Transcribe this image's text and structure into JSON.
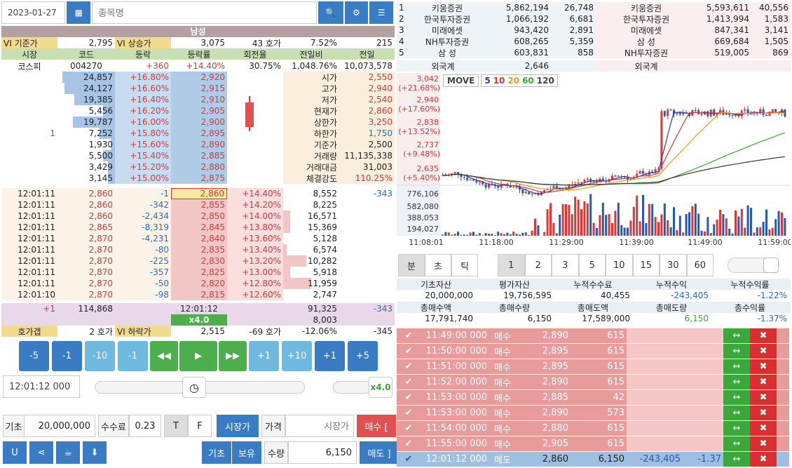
{
  "top": {
    "date": "2023-01-27",
    "stock_placeholder": "종목명"
  },
  "title": "남성",
  "vi": {
    "base_label": "VI 기준가",
    "base": "2,795",
    "up_label": "VI 상승가",
    "up": "3,075",
    "ticks": "43 호가",
    "pct": "7.52%",
    "val": "215"
  },
  "hdr": [
    "시장",
    "코드",
    "등락",
    "등락률",
    "회전율",
    "전일비",
    "전일"
  ],
  "info": [
    "코스피",
    "004270",
    "+360",
    "+14.40%",
    "30.75%",
    "1,048.76%",
    "10,073,578"
  ],
  "asks": [
    {
      "cnt": "",
      "qty": "24,857",
      "pct": "+16.80%",
      "price": "2,920",
      "w": 75
    },
    {
      "cnt": "",
      "qty": "24,127",
      "pct": "+16.60%",
      "price": "2,915",
      "w": 72
    },
    {
      "cnt": "",
      "qty": "19,385",
      "pct": "+16.40%",
      "price": "2,910",
      "w": 58
    },
    {
      "cnt": "",
      "qty": "5,456",
      "pct": "+16.20%",
      "price": "2,905",
      "w": 17
    },
    {
      "cnt": "",
      "qty": "19,787",
      "pct": "+16.00%",
      "price": "2,900",
      "w": 60
    },
    {
      "cnt": "1",
      "qty": "7,252",
      "pct": "+15.80%",
      "price": "2,895",
      "w": 22
    },
    {
      "cnt": "",
      "qty": "1,930",
      "pct": "+15.60%",
      "price": "2,890",
      "w": 6
    },
    {
      "cnt": "",
      "qty": "5,500",
      "pct": "+15.40%",
      "price": "2,885",
      "w": 17
    },
    {
      "cnt": "",
      "qty": "3,429",
      "pct": "+15.20%",
      "price": "2,880",
      "w": 10
    },
    {
      "cnt": "",
      "qty": "3,145",
      "pct": "+15.00%",
      "price": "2,875",
      "w": 10
    }
  ],
  "stats": [
    {
      "k": "시가",
      "v": "2,550",
      "c": "red"
    },
    {
      "k": "고가",
      "v": "2,940",
      "c": "red"
    },
    {
      "k": "저가",
      "v": "2,540",
      "c": "red"
    },
    {
      "k": "현재가",
      "v": "2,860",
      "c": "red"
    },
    {
      "k": "상한가",
      "v": "3,250",
      "c": "red"
    },
    {
      "k": "하한가",
      "v": "1,750",
      "c": "blue"
    },
    {
      "k": "기준가",
      "v": "2,500",
      "c": ""
    },
    {
      "k": "거래량",
      "v": "11,135,338",
      "c": ""
    },
    {
      "k": "거래대금",
      "v": "31,003",
      "c": ""
    },
    {
      "k": "체결강도",
      "v": "110.25%",
      "c": "red"
    }
  ],
  "ticks": [
    {
      "t": "12:01:11",
      "p": "2,860",
      "d": "-1",
      "bp": "2,860",
      "pct": "+14.40%",
      "q": "8,552",
      "x": "-343",
      "w": 0
    },
    {
      "t": "12:01:11",
      "p": "2,860",
      "d": "-342",
      "bp": "2,855",
      "pct": "+14.20%",
      "q": "8,225",
      "x": "",
      "w": 0
    },
    {
      "t": "12:01:11",
      "p": "2,860",
      "d": "-2,434",
      "bp": "2,850",
      "pct": "+14.00%",
      "q": "16,571",
      "x": "",
      "w": 10
    },
    {
      "t": "12:01:11",
      "p": "2,865",
      "d": "-8,319",
      "bp": "2,845",
      "pct": "+13.80%",
      "q": "15,369",
      "x": "",
      "w": 10
    },
    {
      "t": "12:01:11",
      "p": "2,870",
      "d": "-4,231",
      "bp": "2,840",
      "pct": "+13.60%",
      "q": "5,128",
      "x": "",
      "w": 0
    },
    {
      "t": "12:01:11",
      "p": "2,870",
      "d": "-80",
      "bp": "2,835",
      "pct": "+13.40%",
      "q": "6,574",
      "x": "",
      "w": 5
    },
    {
      "t": "12:01:11",
      "p": "2,870",
      "d": "-225",
      "bp": "2,830",
      "pct": "+13.20%",
      "q": "10,282",
      "x": "",
      "w": 33
    },
    {
      "t": "12:01:11",
      "p": "2,870",
      "d": "-357",
      "bp": "2,825",
      "pct": "+13.00%",
      "q": "5,918",
      "x": "",
      "w": 10
    },
    {
      "t": "12:01:11",
      "p": "2,870",
      "d": "-50",
      "bp": "2,820",
      "pct": "+12.80%",
      "q": "11,959",
      "x": "",
      "w": 40
    },
    {
      "t": "12:01:10",
      "p": "2,870",
      "d": "-98",
      "bp": "2,815",
      "pct": "+12.60%",
      "q": "2,747",
      "x": "",
      "w": 0
    }
  ],
  "sum": {
    "cnt": "+1",
    "qty": "114,868",
    "time": "12:01:12",
    "bq": "91,325",
    "x": "-343",
    "speed": "x4.0",
    "q2": "8,003"
  },
  "gap": {
    "label": "호가갭",
    "ticks": "2 호가",
    "down_label": "VI 하락가",
    "down": "2,515",
    "dt": "-69 호가",
    "dp": "-12.06%",
    "dv": "-345"
  },
  "ctrl": [
    "-5",
    "-1",
    "-10",
    "-1",
    "◀◀",
    "▶",
    "▶▶",
    "+1",
    "+10",
    "+1",
    "+5"
  ],
  "time_field": "12:01:12 000",
  "speed_label": "x4.0",
  "trade": {
    "base_label": "기초",
    "base": "20,000,000",
    "fee_label": "수수료",
    "fee": "0.23",
    "t": "T",
    "f": "F",
    "market": "시장가",
    "price_label": "가격",
    "price_ph": "시장가",
    "buy": "매수 [",
    "qty_label": "수량",
    "qty": "6,150",
    "sell": "매도 ]",
    "b1": "기초",
    "b2": "보유"
  },
  "brokers": [
    {
      "n": "1",
      "s": "키움증권",
      "q": "5,862,194",
      "v": "26,748",
      "b": "키움증권",
      "bq": "5,593,611",
      "bv": "40,556"
    },
    {
      "n": "2",
      "s": "한국투자증권",
      "q": "1,066,192",
      "v": "6,681",
      "b": "한국투자증권",
      "bq": "1,413,994",
      "bv": "1,583"
    },
    {
      "n": "3",
      "s": "미래에셋",
      "q": "943,420",
      "v": "2,891",
      "b": "미래에셋",
      "bq": "847,341",
      "bv": "3,141"
    },
    {
      "n": "4",
      "s": "NH투자증권",
      "q": "608,265",
      "v": "5,359",
      "b": "삼 성",
      "bq": "669,684",
      "bv": "1,505"
    },
    {
      "n": "5",
      "s": "삼 성",
      "q": "603,831",
      "v": "858",
      "b": "NH투자증권",
      "bq": "519,005",
      "bv": "869"
    }
  ],
  "foreign": {
    "label": "외국계",
    "q": "2,646",
    "label2": "외국계"
  },
  "chart": {
    "move": "MOVE",
    "ma": [
      "5",
      "10",
      "20",
      "60",
      "120"
    ],
    "prices": [
      {
        "p": "3,042",
        "r": "(+21.68%)"
      },
      {
        "p": "2,940",
        "r": "(+17.60%)"
      },
      {
        "p": "2,838",
        "r": "(+13.52%)"
      },
      {
        "p": "2,737",
        "r": "(+9.48%)"
      },
      {
        "p": "2,635",
        "r": "(+5.40%)"
      }
    ],
    "vols": [
      "776,106",
      "582,080",
      "388,053",
      "194,027"
    ],
    "times": [
      "11:08:01",
      "11:18:00",
      "11:29:00",
      "11:39:00",
      "11:49:00",
      "11:59:00"
    ]
  },
  "chart_data": {
    "type": "candlestick",
    "ylim": [
      2600,
      3050
    ],
    "volume_max": 776106
  },
  "period": {
    "types": [
      "분",
      "초",
      "틱"
    ],
    "vals": [
      "1",
      "2",
      "3",
      "5",
      "10",
      "15",
      "30",
      "60"
    ]
  },
  "acct": {
    "h1": [
      "기초자산",
      "평가자산",
      "누적수수료",
      "누적수익",
      "누적수익률"
    ],
    "v1": [
      "20,000,000",
      "19,756,595",
      "40,455",
      "-243,405",
      "-1.22%"
    ],
    "h2": [
      "총매수액",
      "총매수량",
      "총매도액",
      "총매도량",
      "총수익률"
    ],
    "v2": [
      "17,791,740",
      "6,150",
      "17,589,000",
      "6,150",
      "-1.37%"
    ]
  },
  "orders": [
    {
      "t": "11:49:00 000",
      "s": "매수",
      "p": "2,890",
      "q": "615"
    },
    {
      "t": "11:50:00 000",
      "s": "매수",
      "p": "2,895",
      "q": "615"
    },
    {
      "t": "11:51:00 000",
      "s": "매수",
      "p": "2,895",
      "q": "615"
    },
    {
      "t": "11:52:00 000",
      "s": "매수",
      "p": "2,890",
      "q": "615"
    },
    {
      "t": "11:53:00 000",
      "s": "매수",
      "p": "2,885",
      "q": "42"
    },
    {
      "t": "11:53:00 000",
      "s": "매수",
      "p": "2,890",
      "q": "573"
    },
    {
      "t": "11:54:00 000",
      "s": "매수",
      "p": "2,880",
      "q": "615"
    },
    {
      "t": "11:55:00 000",
      "s": "매수",
      "p": "2,905",
      "q": "615"
    }
  ],
  "last_order": {
    "t": "12:01:12 000",
    "s": "매도",
    "p": "2,860",
    "q": "6,150",
    "pl": "-243,405",
    "r": "-1.37"
  }
}
